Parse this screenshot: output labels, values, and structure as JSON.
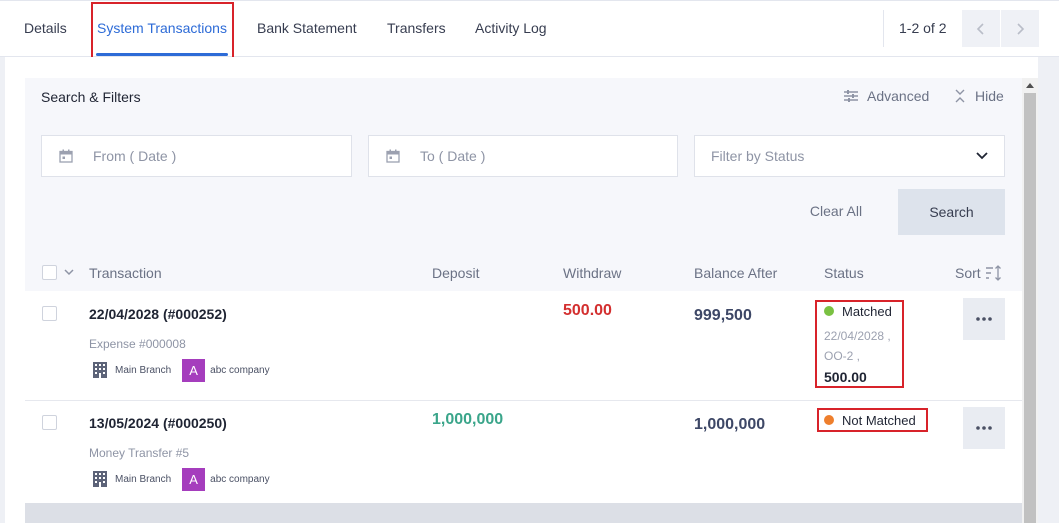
{
  "tabs": [
    {
      "label": "Details"
    },
    {
      "label": "System Transactions",
      "active": true
    },
    {
      "label": "Bank Statement"
    },
    {
      "label": "Transfers"
    },
    {
      "label": "Activity Log"
    }
  ],
  "pager": {
    "text": "1-2 of 2",
    "prev_icon": "chevron-left-icon",
    "next_icon": "chevron-right-icon"
  },
  "filters": {
    "title": "Search & Filters",
    "advanced_label": "Advanced",
    "hide_label": "Hide",
    "from_placeholder": "From ( Date )",
    "to_placeholder": "To ( Date )",
    "status_placeholder": "Filter by Status",
    "clear_label": "Clear All",
    "search_label": "Search"
  },
  "table": {
    "headers": {
      "transaction": "Transaction",
      "deposit": "Deposit",
      "withdraw": "Withdraw",
      "balance": "Balance After",
      "status": "Status",
      "sort": "Sort"
    },
    "rows": [
      {
        "title": "22/04/2028 (#000252)",
        "subtitle": "Expense #000008",
        "branch": "Main Branch",
        "avatar_letter": "A",
        "company": "abc company",
        "deposit": "",
        "withdraw": "500.00",
        "balance": "999,500",
        "status": "Matched",
        "match_date": "22/04/2028 ,",
        "match_ref": "OO-2 ,",
        "match_amount": "500.00"
      },
      {
        "title": "13/05/2024 (#000250)",
        "subtitle": "Money Transfer #5",
        "branch": "Main Branch",
        "avatar_letter": "A",
        "company": "abc company",
        "deposit": "1,000,000",
        "withdraw": "",
        "balance": "1,000,000",
        "status": "Not Matched"
      }
    ]
  },
  "colors": {
    "accent": "#2d6bd7",
    "withdraw": "#d32f2f",
    "deposit": "#3aa58a",
    "balance": "#3d4766",
    "matched": "#7ac142",
    "not_matched": "#ee7f2d",
    "highlight": "#d8232a",
    "avatar": "#a53dbd"
  }
}
